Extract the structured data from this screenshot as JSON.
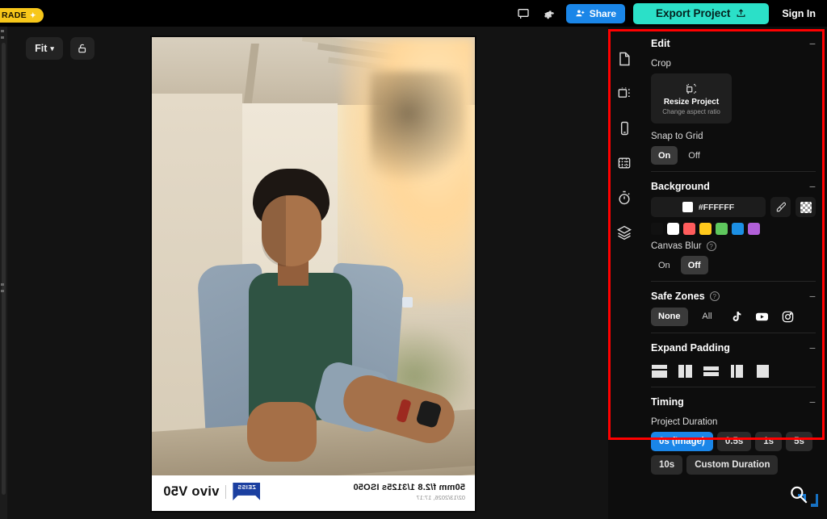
{
  "topbar": {
    "upgrade_label": "RADE",
    "feedback_icon": "comment-icon",
    "settings_icon": "gear-icon",
    "share_label": "Share",
    "export_label": "Export Project",
    "signin_label": "Sign In"
  },
  "canvas": {
    "zoom_label": "Fit",
    "lock_icon": "unlock-icon",
    "photo": {
      "caption_specs": "50mm f/2.8 1/3125s ISO50",
      "caption_timestamp": "02/13/2026, 17:17",
      "lens_brand": "ZEISS",
      "device_brand": "vivo V50"
    }
  },
  "icon_rail": [
    {
      "name": "page-icon"
    },
    {
      "name": "resize-icon"
    },
    {
      "name": "device-icon"
    },
    {
      "name": "grid-icon"
    },
    {
      "name": "timer-icon"
    },
    {
      "name": "layers-icon"
    }
  ],
  "panel": {
    "edit": {
      "title": "Edit",
      "crop_label": "Crop",
      "resize_card_title": "Resize Project",
      "resize_card_sub": "Change aspect ratio",
      "snap_label": "Snap to Grid",
      "snap_options": [
        "On",
        "Off"
      ],
      "snap_selected": "On"
    },
    "background": {
      "title": "Background",
      "hex_value": "#FFFFFF",
      "eyedropper_icon": "eyedropper-icon",
      "transparent_icon": "transparency-icon",
      "swatches": [
        "#111111",
        "#FFFFFF",
        "#FF5C5C",
        "#FFC91C",
        "#5FC75D",
        "#1C8FE3",
        "#B15FD8"
      ],
      "canvas_blur_label": "Canvas Blur",
      "canvas_blur_options": [
        "On",
        "Off"
      ],
      "canvas_blur_selected": "Off"
    },
    "safe_zones": {
      "title": "Safe Zones",
      "options": [
        "None",
        "All"
      ],
      "selected": "None",
      "platforms": [
        "tiktok-icon",
        "youtube-icon",
        "instagram-icon"
      ]
    },
    "expand_padding": {
      "title": "Expand Padding",
      "presets": [
        "pad-top-bottom",
        "pad-left-right",
        "pad-bottom",
        "pad-left",
        "pad-none"
      ]
    },
    "timing": {
      "title": "Timing",
      "duration_label": "Project Duration",
      "options": [
        "0s (Image)",
        "0.5s",
        "1s",
        "5s",
        "10s",
        "Custom Duration"
      ],
      "selected": "0s (Image)"
    }
  },
  "colors": {
    "accent_blue": "#1A86E8",
    "export_teal": "#2BE0C8",
    "upgrade_yellow": "#F7C71A",
    "highlight_red": "#FF0000"
  }
}
